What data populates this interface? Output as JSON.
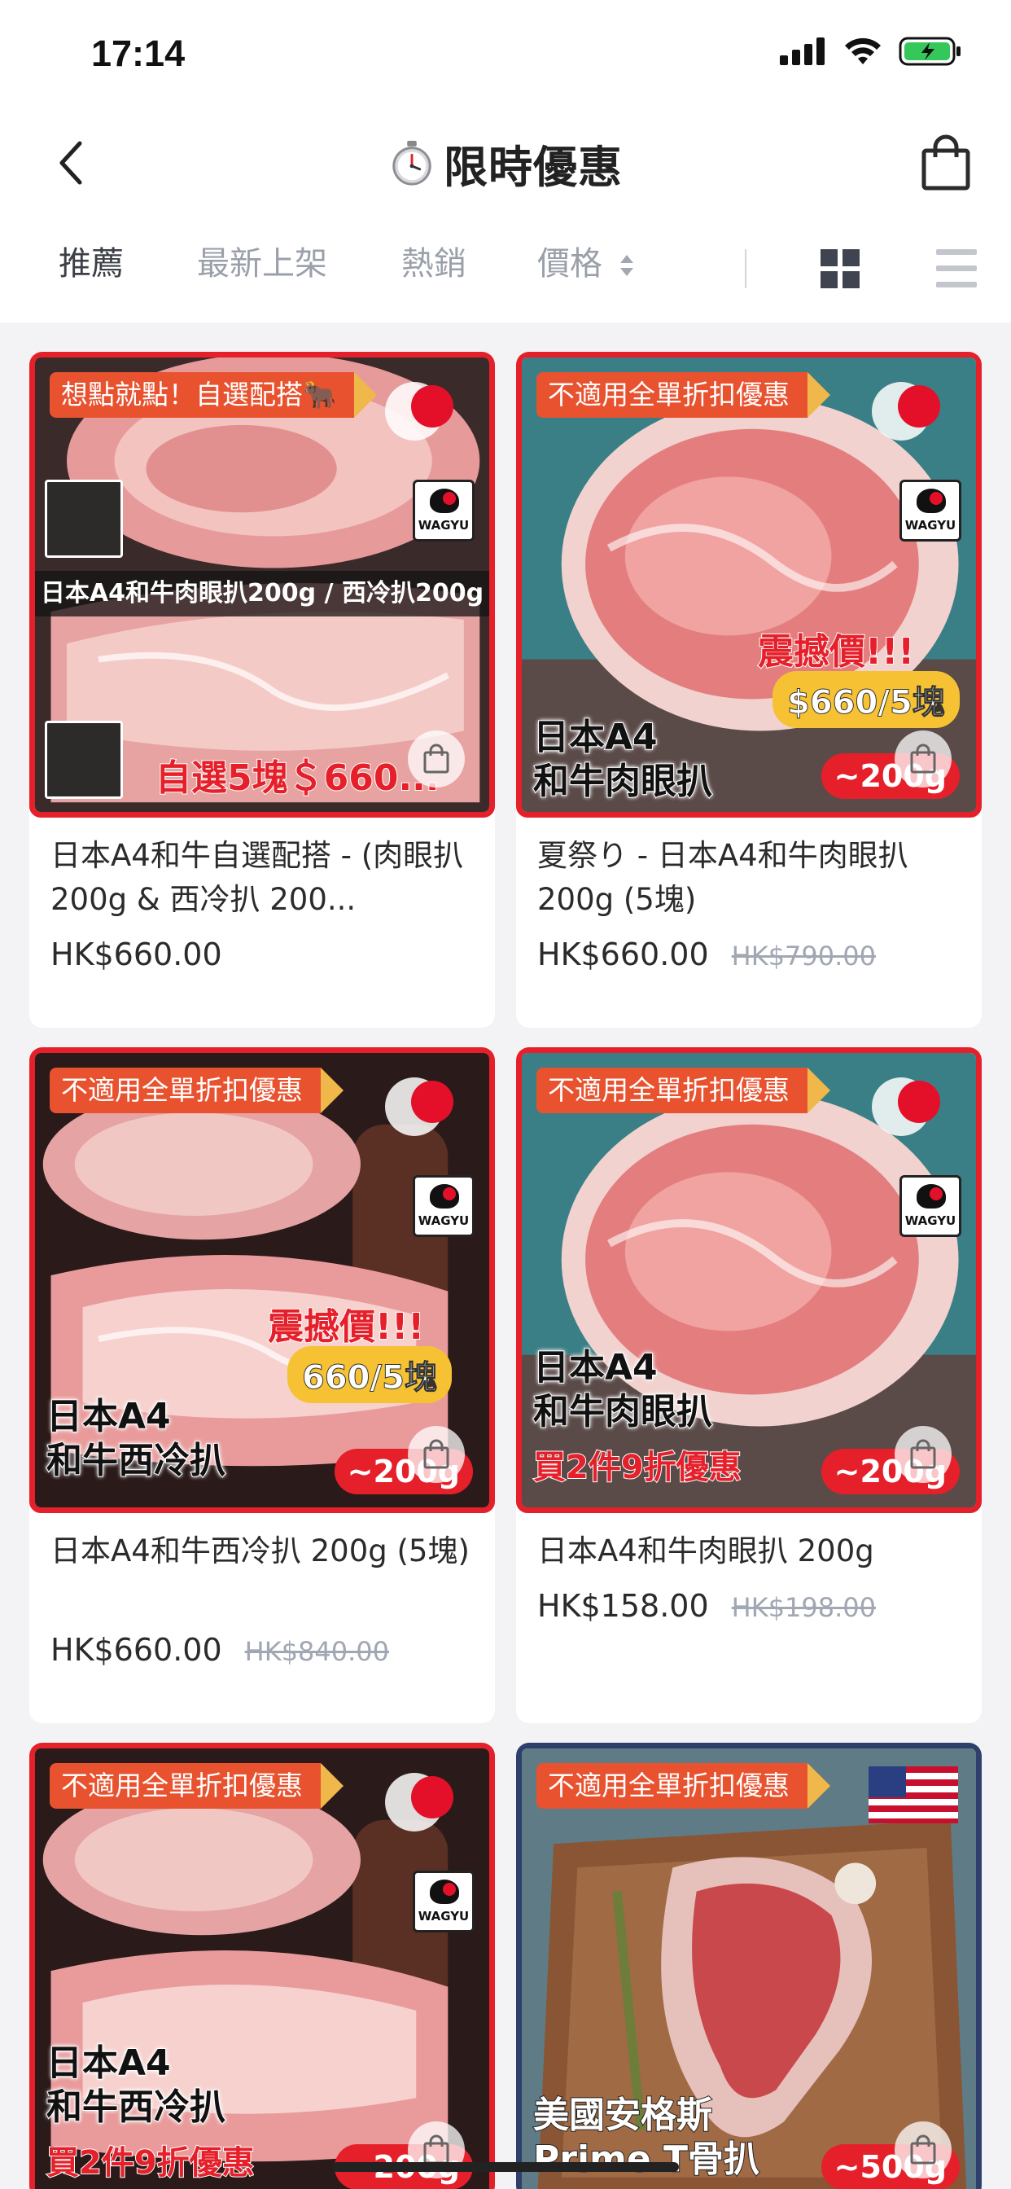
{
  "status_bar": {
    "time": "17:14"
  },
  "header": {
    "title": "限時優惠",
    "title_icon": "stopwatch-icon"
  },
  "sort_tabs": [
    {
      "label": "推薦",
      "active": true
    },
    {
      "label": "最新上架",
      "active": false
    },
    {
      "label": "熱銷",
      "active": false
    },
    {
      "label": "價格",
      "active": false
    }
  ],
  "view_modes": [
    "grid-view-icon",
    "list-view-icon"
  ],
  "products": [
    {
      "tag": "想點就點！自選配搭🐂",
      "image_text": [
        "日本A4和牛肉眼扒200g / 西冷扒200g",
        "自選5塊＄660..."
      ],
      "name": "日本A4和牛自選配搭 - (肉眼扒 200g & 西冷扒 200...",
      "price": "HK$660.00",
      "old_price": ""
    },
    {
      "tag": "不適用全單折扣優惠",
      "image_text": [
        "震撼價!!!",
        "$660/5塊",
        "日本A4",
        "和牛肉眼扒",
        "~200g"
      ],
      "name": "夏祭り - 日本A4和牛肉眼扒 200g (5塊)",
      "price": "HK$660.00",
      "old_price": "HK$790.00"
    },
    {
      "tag": "不適用全單折扣優惠",
      "image_text": [
        "震撼價!!!",
        "660/5塊",
        "日本A4",
        "和牛西冷扒",
        "~200g"
      ],
      "name": "日本A4和牛西冷扒 200g (5塊)",
      "price": "HK$660.00",
      "old_price": "HK$840.00"
    },
    {
      "tag": "不適用全單折扣優惠",
      "image_text": [
        "日本A4",
        "和牛肉眼扒",
        "買2件9折優惠",
        "~200g"
      ],
      "name": "日本A4和牛肉眼扒 200g",
      "price": "HK$158.00",
      "old_price": "HK$198.00"
    },
    {
      "tag": "不適用全單折扣優惠",
      "image_text": [
        "日本A4",
        "和牛西冷扒",
        "買2件9折優惠",
        "~200g"
      ],
      "name": "",
      "price": "",
      "old_price": ""
    },
    {
      "tag": "不適用全單折扣優惠",
      "image_text": [
        "美國安格斯",
        "Prime T骨扒",
        "~500g"
      ],
      "name": "",
      "price": "",
      "old_price": ""
    }
  ],
  "logo_text": "WAGYU",
  "colors": {
    "accent_red": "#e5202a",
    "tag_orange": "#e8522f",
    "tag_gold": "#f0b84a",
    "muted": "#a1a7b3"
  }
}
